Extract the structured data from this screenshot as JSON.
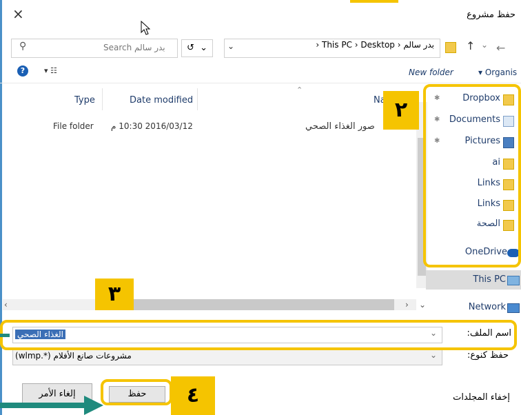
{
  "window": {
    "title": "حفظ مشروع",
    "close_glyph": "×"
  },
  "address_bar": {
    "crumbs": [
      "This PC",
      "Desktop",
      "بدر سالم"
    ],
    "separator": "›",
    "refresh_glyph": "↺",
    "dropdown_glyph": "⌄"
  },
  "search": {
    "placeholder": "Search بدر سالم"
  },
  "toolbar": {
    "new_folder": "New folder",
    "organise": "▾ Organis",
    "help": "?",
    "view": "▾ ☷"
  },
  "columns": {
    "name": "Na",
    "date_modified": "Date modified",
    "type": "Type"
  },
  "rows": [
    {
      "name": "صور الغذاء الصحي",
      "date": "2016/03/12 10:30 م",
      "type": "File folder"
    }
  ],
  "nav_pane": {
    "items": [
      {
        "label": "Dropbox",
        "pinned": true
      },
      {
        "label": "Documents",
        "pinned": true
      },
      {
        "label": "Pictures",
        "pinned": true
      },
      {
        "label": "ai",
        "pinned": false
      },
      {
        "label": "Links",
        "pinned": false
      },
      {
        "label": "Links",
        "pinned": false
      },
      {
        "label": "الصحة",
        "pinned": false
      },
      {
        "label": "OneDrive",
        "pinned": false
      },
      {
        "label": "This PC",
        "pinned": false
      },
      {
        "label": "Network",
        "pinned": false
      }
    ]
  },
  "form": {
    "filename_label": "اسم الملف:",
    "filename_value": "الغذاء الصحي",
    "savetype_label": "حفظ كنوع:",
    "savetype_value": "مشروعات صانع الأفلام (*.wlmp)"
  },
  "footer": {
    "hide_folders": "إخفاء المجلدات",
    "save_button": "حفظ",
    "cancel_button": "إلغاء الأمر"
  },
  "annotations": {
    "badge2": "٢",
    "badge3": "٣",
    "badge4": "٤"
  },
  "colors": {
    "highlight": "#f5c400",
    "arrow": "#1f8a7d",
    "selection": "#3b6fb6"
  }
}
